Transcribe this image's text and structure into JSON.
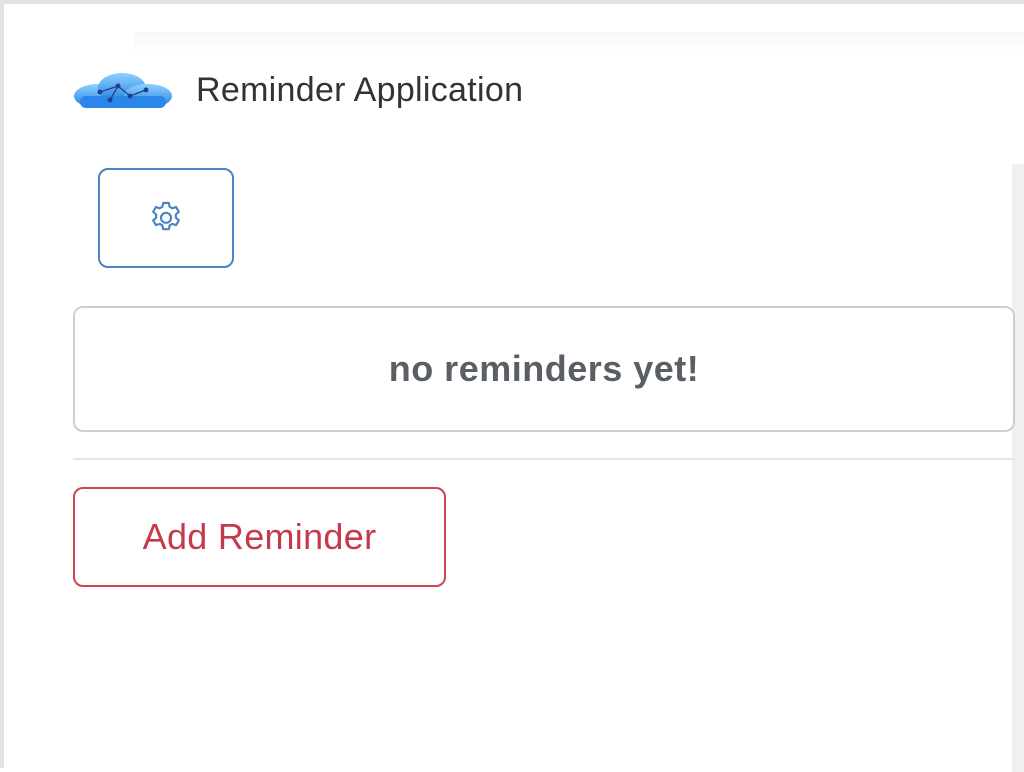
{
  "app": {
    "title": "Reminder Application",
    "logo_icon": "cloud-logo-icon"
  },
  "toolbar": {
    "settings_icon": "gear-icon",
    "settings_color": "#4a84c4"
  },
  "reminders": {
    "items": [],
    "empty_message": "no reminders yet!"
  },
  "actions": {
    "add_label": "Add Reminder",
    "add_color": "#c43a4b"
  },
  "colors": {
    "accent_blue": "#4a84c4",
    "danger_red": "#d04454",
    "text_dark": "#333333",
    "text_muted": "#5a5f66"
  }
}
